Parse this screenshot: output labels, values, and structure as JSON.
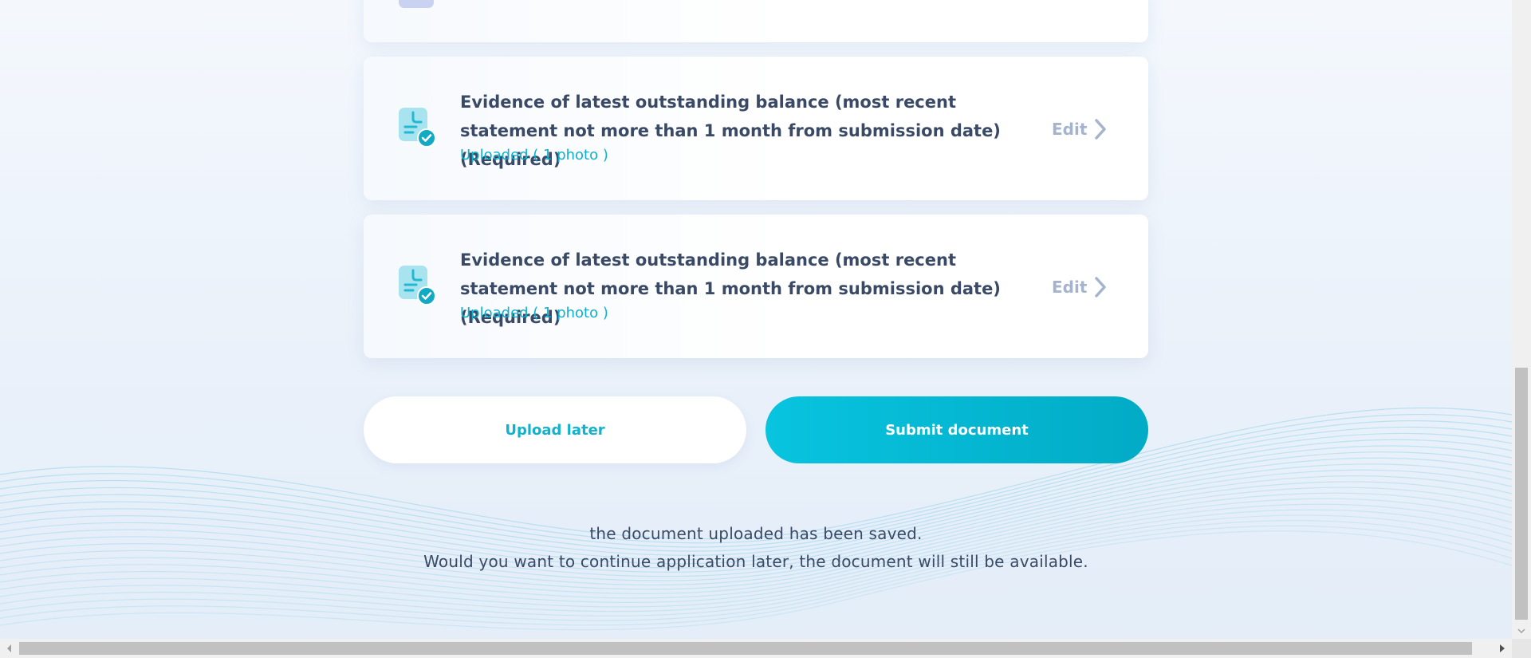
{
  "documents": [
    {
      "title": "Evidence of latest outstanding balance (most recent statement not more than 1 month from submission date) (Required)",
      "status": "Uploaded ( 1 photo )",
      "edit_label": "Edit",
      "icon": "document-check-icon"
    },
    {
      "title": "Evidence of latest outstanding balance (most recent statement not more than 1 month from submission date) (Required)",
      "status": "Uploaded ( 1 photo )",
      "edit_label": "Edit",
      "icon": "document-check-icon"
    }
  ],
  "actions": {
    "upload_later_label": "Upload later",
    "submit_label": "Submit document"
  },
  "notice": {
    "line1": "the document uploaded has been saved.",
    "line2": "Would you want to continue application later, the document will still be available."
  },
  "colors": {
    "accent": "#08bfdb",
    "status_text": "#0fb0cc",
    "title_text": "#3a4a66",
    "edit_text": "#a5b4cc"
  }
}
